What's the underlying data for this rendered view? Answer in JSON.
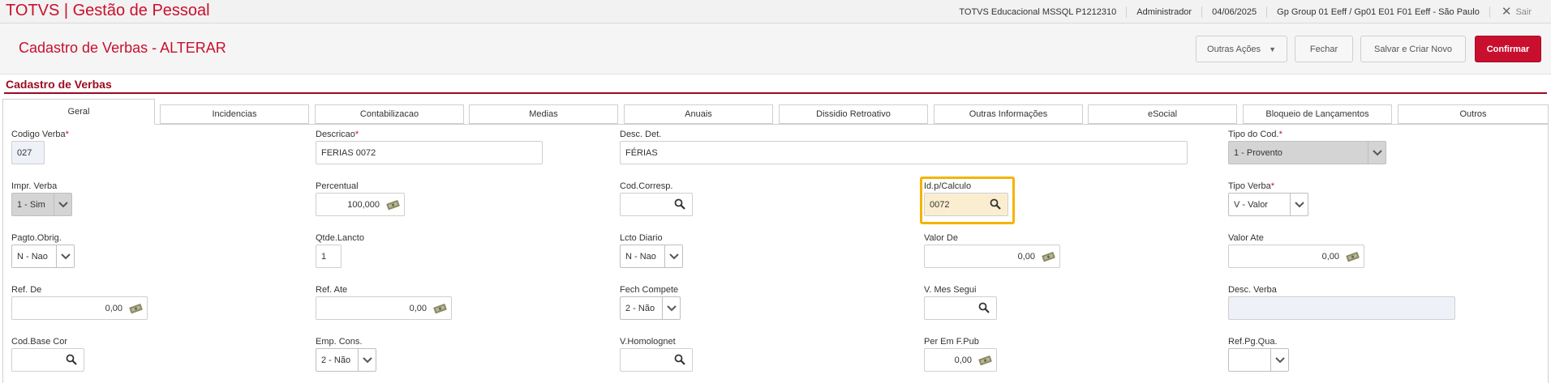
{
  "app": {
    "title": "TOTVS | Gestão de Pessoal",
    "environment": "TOTVS Educacional MSSQL P1212310",
    "user": "Administrador",
    "date": "04/06/2025",
    "branch": "Gp Group 01 Eeff / Gp01 E01 F01 Eeff - São Paulo",
    "exit_label": "Sair"
  },
  "header": {
    "title": "Cadastro de Verbas - ALTERAR",
    "buttons": {
      "other_actions": "Outras Ações",
      "close": "Fechar",
      "save_new": "Salvar e Criar Novo",
      "confirm": "Confirmar"
    }
  },
  "section": {
    "title": "Cadastro de Verbas"
  },
  "tabs": [
    {
      "label": "Geral",
      "active": true
    },
    {
      "label": "Incidencias"
    },
    {
      "label": "Contabilizacao"
    },
    {
      "label": "Medias"
    },
    {
      "label": "Anuais"
    },
    {
      "label": "Dissidio Retroativo"
    },
    {
      "label": "Outras Informações"
    },
    {
      "label": "eSocial"
    },
    {
      "label": "Bloqueio de Lançamentos"
    },
    {
      "label": "Outros"
    }
  ],
  "fields": {
    "codigo_verba": {
      "label": "Codigo Verba",
      "value": "027"
    },
    "descricao": {
      "label": "Descricao",
      "value": "FERIAS 0072"
    },
    "desc_det": {
      "label": "Desc. Det.",
      "value": "FÉRIAS"
    },
    "tipo_cod": {
      "label": "Tipo do Cod.",
      "value": "1 - Provento"
    },
    "impr_verba": {
      "label": "Impr. Verba",
      "value": "1 - Sim"
    },
    "percentual": {
      "label": "Percentual",
      "value": "100,000"
    },
    "cod_corresp": {
      "label": "Cod.Corresp.",
      "value": ""
    },
    "id_calculo": {
      "label": "Id.p/Calculo",
      "value": "0072"
    },
    "tipo_verba": {
      "label": "Tipo Verba",
      "value": "V - Valor"
    },
    "pagto_obrig": {
      "label": "Pagto.Obrig.",
      "value": "N - Nao"
    },
    "qtde_lancto": {
      "label": "Qtde.Lancto",
      "value": "1"
    },
    "lcto_diario": {
      "label": "Lcto Diario",
      "value": "N - Nao"
    },
    "valor_de": {
      "label": "Valor De",
      "value": "0,00"
    },
    "valor_ate": {
      "label": "Valor Ate",
      "value": "0,00"
    },
    "ref_de": {
      "label": "Ref. De",
      "value": "0,00"
    },
    "ref_ate": {
      "label": "Ref. Ate",
      "value": "0,00"
    },
    "fech_compete": {
      "label": "Fech Compete",
      "value": "2 - Não"
    },
    "v_mes_segui": {
      "label": "V. Mes Segui",
      "value": ""
    },
    "desc_verba": {
      "label": "Desc. Verba",
      "value": ""
    },
    "cod_base_cor": {
      "label": "Cod.Base Cor",
      "value": ""
    },
    "emp_cons": {
      "label": "Emp. Cons.",
      "value": "2 - Não"
    },
    "v_homolognet": {
      "label": "V.Homolognet",
      "value": ""
    },
    "per_em_f_pub": {
      "label": "Per Em F.Pub",
      "value": "0,00"
    },
    "ref_pg_qua": {
      "label": "Ref.Pg.Qua.",
      "value": ""
    }
  },
  "colors": {
    "brand": "#c8102e",
    "highlight": "#f5b400"
  }
}
